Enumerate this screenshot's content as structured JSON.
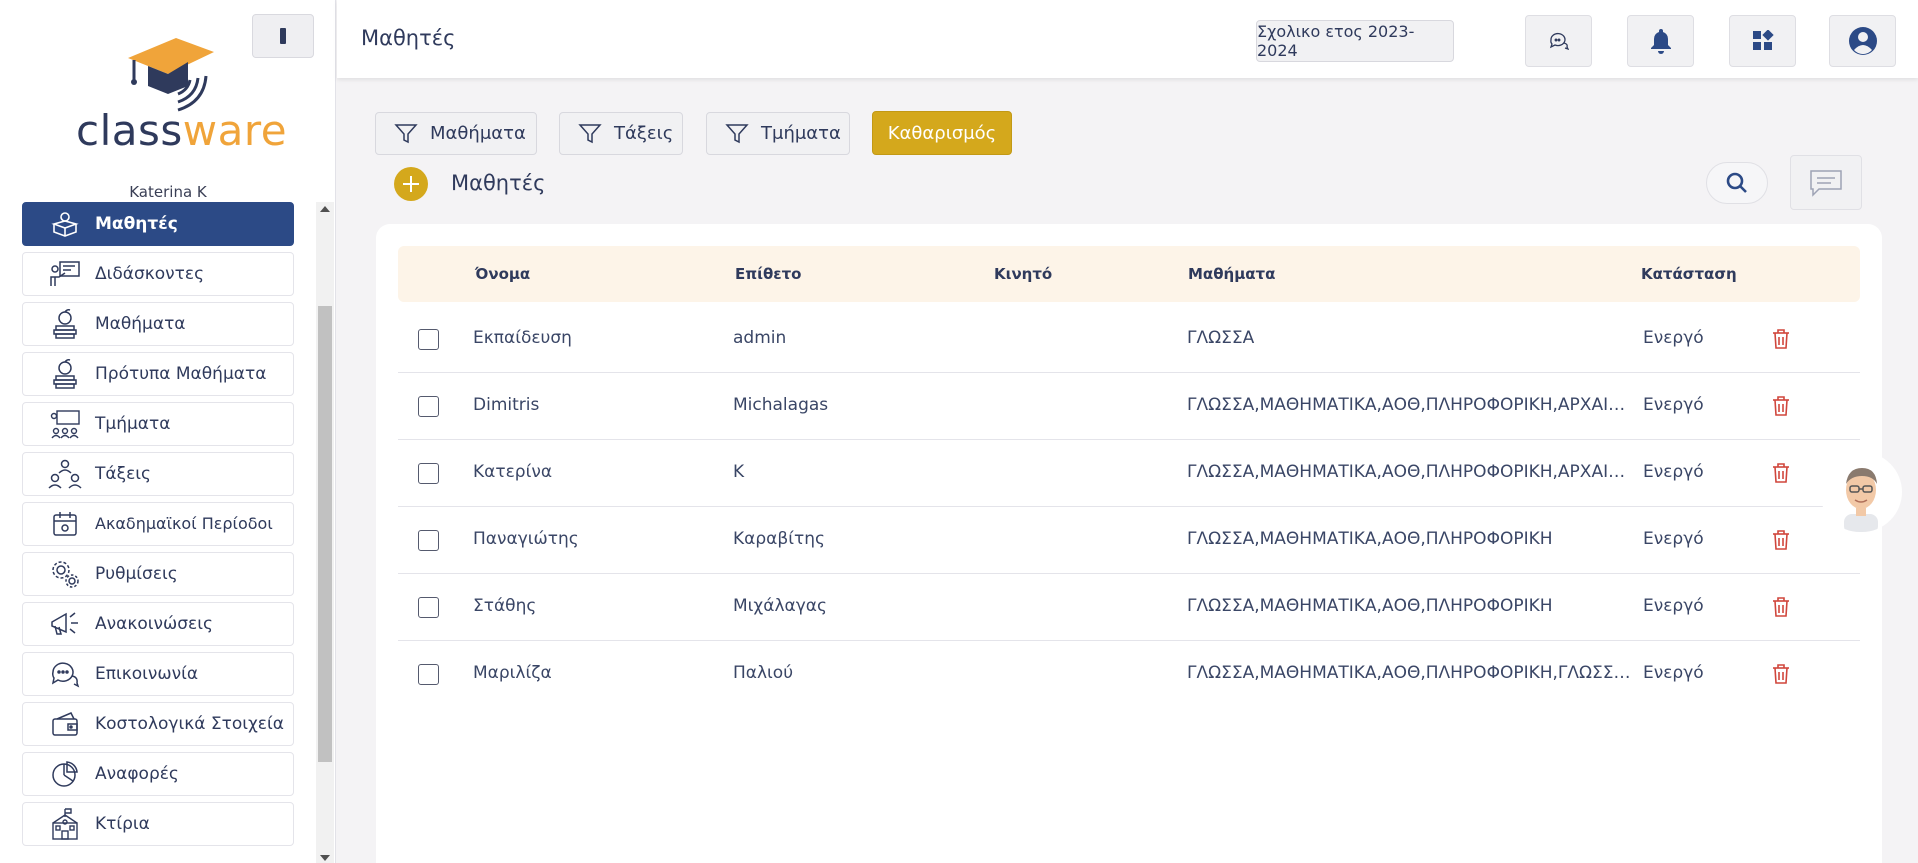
{
  "app": {
    "logo": {
      "part1": "class",
      "part2": "ware"
    },
    "user_name": "Katerina K"
  },
  "sidebar": {
    "items": [
      {
        "label": "Μαθητές",
        "icon": "students-box-icon",
        "active": true
      },
      {
        "label": "Διδάσκοντες",
        "icon": "teacher-board-icon",
        "active": false
      },
      {
        "label": "Μαθήματα",
        "icon": "apple-books-icon",
        "active": false
      },
      {
        "label": "Πρότυπα Μαθήματα",
        "icon": "apple-books-template-icon",
        "active": false
      },
      {
        "label": "Τμήματα",
        "icon": "classroom-group-icon",
        "active": false
      },
      {
        "label": "Τάξεις",
        "icon": "hierarchy-people-icon",
        "active": false
      },
      {
        "label": "Ακαδημαϊκοί Περίοδοι",
        "icon": "calendar-icon",
        "active": false
      },
      {
        "label": "Ρυθμίσεις",
        "icon": "gears-icon",
        "active": false
      },
      {
        "label": "Ανακοινώσεις",
        "icon": "megaphone-icon",
        "active": false
      },
      {
        "label": "Επικοινωνία",
        "icon": "chat-bubbles-icon",
        "active": false
      },
      {
        "label": "Κοστολογικά Στοιχεία",
        "icon": "wallet-card-icon",
        "active": false
      },
      {
        "label": "Αναφορές",
        "icon": "pie-chart-icon",
        "active": false
      },
      {
        "label": "Κτίρια",
        "icon": "school-building-icon",
        "active": false
      }
    ]
  },
  "header": {
    "title": "Μαθητές",
    "school_year": "Σχολικο ετος 2023-2024",
    "icons": [
      "chat-icon",
      "bell-icon",
      "apps-grid-icon",
      "user-account-icon"
    ]
  },
  "filters": [
    {
      "label": "Μαθήματα"
    },
    {
      "label": "Τάξεις"
    },
    {
      "label": "Τμήματα"
    }
  ],
  "clear_label": "Καθαρισμός",
  "list": {
    "title": "Μαθητές",
    "columns": {
      "first_name": "Όνομα",
      "last_name": "Επίθετο",
      "mobile": "Κινητό",
      "courses": "Μαθήματα",
      "status": "Κατάσταση"
    },
    "rows": [
      {
        "first_name": "Εκπαίδευση",
        "last_name": "admin",
        "mobile": "",
        "courses": "ΓΛΩΣΣΑ",
        "status": "Ενεργό"
      },
      {
        "first_name": "Dimitris",
        "last_name": "Michalagas",
        "mobile": "",
        "courses": "ΓΛΩΣΣΑ,ΜΑΘΗΜΑΤΙΚΑ,ΑΟΘ,ΠΛΗΡΟΦΟΡΙΚΗ,ΑΡΧΑΙΑ,ΙΣΤΟΡΙΑ",
        "status": "Ενεργό"
      },
      {
        "first_name": "Κατερίνα",
        "last_name": "Κ",
        "mobile": "",
        "courses": "ΓΛΩΣΣΑ,ΜΑΘΗΜΑΤΙΚΑ,ΑΟΘ,ΠΛΗΡΟΦΟΡΙΚΗ,ΑΡΧΑΙΑ,ΙΣΤΟΡΙΑ",
        "status": "Ενεργό"
      },
      {
        "first_name": "Παναγιώτης",
        "last_name": "Καραβίτης",
        "mobile": "",
        "courses": "ΓΛΩΣΣΑ,ΜΑΘΗΜΑΤΙΚΑ,ΑΟΘ,ΠΛΗΡΟΦΟΡΙΚΗ",
        "status": "Ενεργό"
      },
      {
        "first_name": "Στάθης",
        "last_name": "Μιχάλαγας",
        "mobile": "",
        "courses": "ΓΛΩΣΣΑ,ΜΑΘΗΜΑΤΙΚΑ,ΑΟΘ,ΠΛΗΡΟΦΟΡΙΚΗ",
        "status": "Ενεργό"
      },
      {
        "first_name": "Μαριλίζα",
        "last_name": "Παλιού",
        "mobile": "",
        "courses": "ΓΛΩΣΣΑ,ΜΑΘΗΜΑΤΙΚΑ,ΑΟΘ,ΠΛΗΡΟΦΟΡΙΚΗ,ΓΛΩΣΣΑ ΑΡΧΑΙΑ",
        "status": "Ενεργό"
      }
    ]
  },
  "colors": {
    "primary": "#2c4a86",
    "accent": "#d4a81c",
    "logo_orange": "#f0a43a",
    "danger": "#d0463c"
  }
}
